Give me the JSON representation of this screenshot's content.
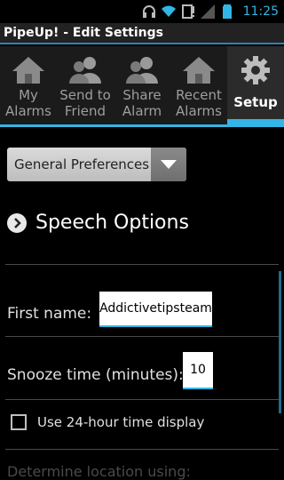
{
  "status": {
    "time": "11:25"
  },
  "title": "PipeUp! - Edit Settings",
  "tabs": [
    {
      "label": "My\nAlarms",
      "icon": "house-icon"
    },
    {
      "label": "Send to\nFriend",
      "icon": "people-icon"
    },
    {
      "label": "Share\nAlarm",
      "icon": "people-icon"
    },
    {
      "label": "Recent\nAlarms",
      "icon": "house-icon"
    },
    {
      "label": "Setup",
      "icon": "gear-icon",
      "active": true
    }
  ],
  "dropdown": {
    "selected": "General Preferences"
  },
  "section": {
    "title": "Speech Options"
  },
  "fields": {
    "first_name": {
      "label": "First name:",
      "value": "Addictivetipsteam"
    },
    "snooze": {
      "label": "Snooze time (minutes):",
      "value": "10"
    }
  },
  "checkbox": {
    "label": "Use 24-hour time display",
    "checked": false
  },
  "faded_text": "Determine location using:",
  "colors": {
    "accent": "#33b5e5",
    "background": "#000000"
  }
}
